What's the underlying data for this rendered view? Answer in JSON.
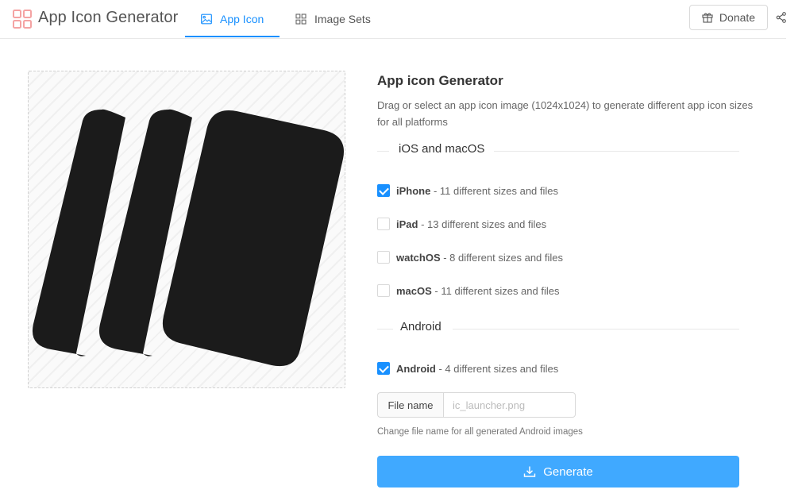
{
  "header": {
    "app_title": "App Icon Generator",
    "tabs": [
      {
        "label": "App Icon",
        "icon": "image-icon",
        "active": true
      },
      {
        "label": "Image Sets",
        "icon": "grid-icon",
        "active": false
      }
    ],
    "donate_label": "Donate",
    "accent_color": "#1890ff"
  },
  "panel": {
    "title": "App icon Generator",
    "description": "Drag or select an app icon image (1024x1024) to generate different app icon sizes for all platforms",
    "ios_section": {
      "label": "iOS and macOS",
      "options": [
        {
          "name": "iPhone",
          "detail": " - 11 different sizes and files",
          "checked": true
        },
        {
          "name": "iPad",
          "detail": " - 13 different sizes and files",
          "checked": false
        },
        {
          "name": "watchOS",
          "detail": " - 8 different sizes and files",
          "checked": false
        },
        {
          "name": "macOS",
          "detail": " - 11 different sizes and files",
          "checked": false
        }
      ]
    },
    "android_section": {
      "label": "Android",
      "options": [
        {
          "name": "Android",
          "detail": " - 4 different sizes and files",
          "checked": true
        }
      ]
    },
    "file_name": {
      "label": "File name",
      "placeholder": "ic_launcher.png",
      "value": "",
      "help": "Change file name for all generated Android images"
    },
    "generate_label": "Generate",
    "generate_color": "#40a9ff"
  }
}
